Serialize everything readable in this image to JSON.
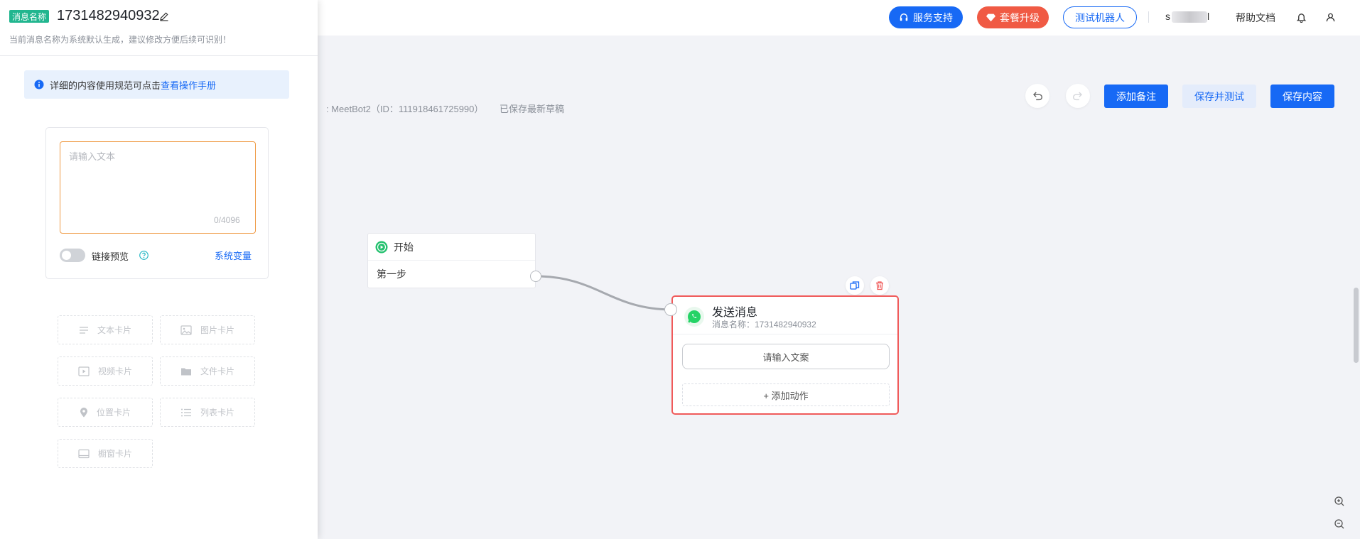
{
  "header": {
    "support_label": "服务支持",
    "upgrade_label": "套餐升级",
    "test_bot_label": "测试机器人",
    "username_visible": "s",
    "username_tail": "l",
    "help_docs_label": "帮助文档"
  },
  "canvas": {
    "breadcrumb": ": MeetBot2（ID：111918461725990）",
    "save_status": "已保存最新草稿",
    "add_note_label": "添加备注",
    "save_test_label": "保存并测试",
    "save_label": "保存内容"
  },
  "start_node": {
    "title": "开始",
    "step_label": "第一步"
  },
  "message_node": {
    "title": "发送消息",
    "subtitle": "消息名称：1731482940932",
    "input_prompt": "请输入文案",
    "add_action_label": "+ 添加动作"
  },
  "drawer": {
    "name_tag": "消息名称",
    "name_value": "1731482940932",
    "name_hint": "当前消息名称为系统默认生成，建议修改方便后续可识别！",
    "info_text": "详细的内容使用规范可点击",
    "info_link": "查看操作手册",
    "text_placeholder": "请输入文本",
    "char_count": "0/4096",
    "link_preview_label": "链接预览",
    "link_preview_enabled": false,
    "system_variables_label": "系统变量",
    "card_buttons": [
      {
        "label": "文本卡片",
        "icon": "text-lines-icon"
      },
      {
        "label": "图片卡片",
        "icon": "image-icon"
      },
      {
        "label": "视频卡片",
        "icon": "video-icon"
      },
      {
        "label": "文件卡片",
        "icon": "folder-icon"
      },
      {
        "label": "位置卡片",
        "icon": "location-pin-icon"
      },
      {
        "label": "列表卡片",
        "icon": "list-icon"
      },
      {
        "label": "橱窗卡片",
        "icon": "showcase-icon"
      }
    ]
  },
  "colors": {
    "primary": "#1769f5",
    "upgrade": "#f05a44",
    "selected_border": "#f05a5a",
    "name_tag": "#21b68f",
    "start_icon": "#25c16f",
    "whatsapp": "#25d366",
    "textarea_focus": "#ef9a44"
  }
}
